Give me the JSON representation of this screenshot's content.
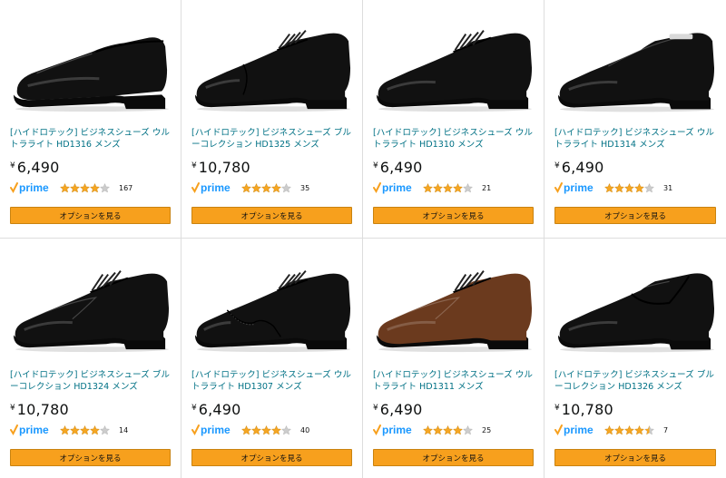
{
  "products": [
    {
      "title": "[ハイドロテック] ビジネスシューズ ウルトラライト HD1316 メンズ",
      "currency": "¥",
      "price": "6,490",
      "rating": 4,
      "reviews": "167",
      "button": "オプションを見る",
      "image_icon": "slip-on-loafer-shoe",
      "shoe_color": "#111111"
    },
    {
      "title": "[ハイドロテック] ビジネスシューズ ブルーコレクション HD1325 メンズ",
      "currency": "¥",
      "price": "10,780",
      "rating": 4,
      "reviews": "35",
      "button": "オプションを見る",
      "image_icon": "cap-toe-oxford-shoe",
      "shoe_color": "#111111"
    },
    {
      "title": "[ハイドロテック] ビジネスシューズ ウルトラライト HD1310 メンズ",
      "currency": "¥",
      "price": "6,490",
      "rating": 4,
      "reviews": "21",
      "button": "オプションを見る",
      "image_icon": "plain-toe-derby-shoe",
      "shoe_color": "#111111"
    },
    {
      "title": "[ハイドロテック] ビジネスシューズ ウルトラライト HD1314 メンズ",
      "currency": "¥",
      "price": "6,490",
      "rating": 4,
      "reviews": "31",
      "button": "オプションを見る",
      "image_icon": "bit-slip-on-shoe",
      "shoe_color": "#111111"
    },
    {
      "title": "[ハイドロテック] ビジネスシューズ ブルーコレクション HD1324 メンズ",
      "currency": "¥",
      "price": "10,780",
      "rating": 4,
      "reviews": "14",
      "button": "オプションを見る",
      "image_icon": "u-tip-derby-shoe",
      "shoe_color": "#111111"
    },
    {
      "title": "[ハイドロテック] ビジネスシューズ ウルトラライト HD1307 メンズ",
      "currency": "¥",
      "price": "6,490",
      "rating": 4,
      "reviews": "40",
      "button": "オプションを見る",
      "image_icon": "wingtip-shoe",
      "shoe_color": "#111111"
    },
    {
      "title": "[ハイドロテック] ビジネスシューズ ウルトラライト HD1311 メンズ",
      "currency": "¥",
      "price": "6,490",
      "rating": 4,
      "reviews": "25",
      "button": "オプションを見る",
      "image_icon": "u-tip-derby-shoe",
      "shoe_color": "#6b3a1e"
    },
    {
      "title": "[ハイドロテック] ビジネスシューズ ブルーコレクション HD1326 メンズ",
      "currency": "¥",
      "price": "10,780",
      "rating": 4.5,
      "reviews": "7",
      "button": "オプションを見る",
      "image_icon": "strap-loafer-shoe",
      "shoe_color": "#111111"
    }
  ],
  "prime_label": "prime",
  "colors": {
    "link": "#007185",
    "star": "#f5a623",
    "star_empty": "#cccccc",
    "button": "#f7a01d",
    "prime_blue": "#1a98ff",
    "prime_check": "#f7a01d"
  }
}
